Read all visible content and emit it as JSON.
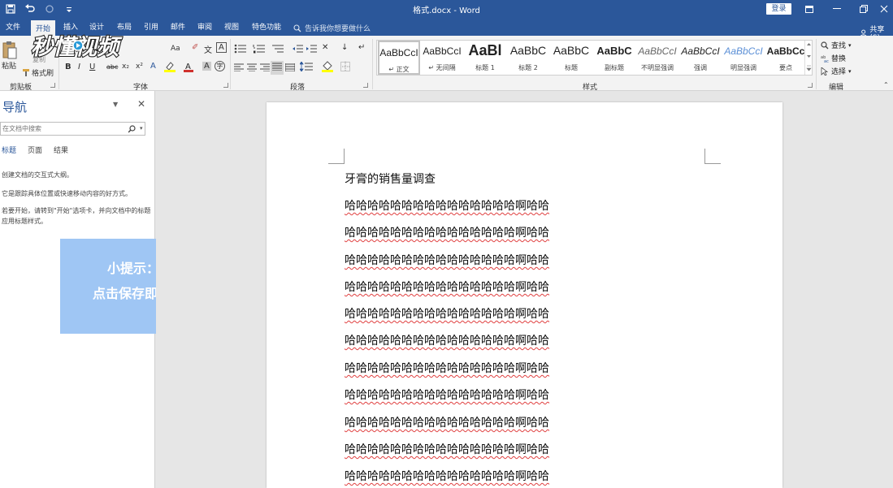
{
  "title_bar": {
    "doc_title": "格式.docx - Word",
    "login": "登录"
  },
  "tabs": [
    "文件",
    "开始",
    "插入",
    "设计",
    "布局",
    "引用",
    "邮件",
    "审阅",
    "视图",
    "特色功能"
  ],
  "tell_me": "告诉我你想要做什么",
  "share": "共享(S)",
  "ribbon": {
    "clipboard": {
      "paste": "粘贴",
      "copy": "复制",
      "format_painter": "格式刷",
      "label": "剪贴板"
    },
    "font": {
      "aa": "Aa",
      "bold": "B",
      "italic": "I",
      "underline": "U",
      "strike": "abc",
      "x2": "x₂",
      "x2sup": "x²",
      "label": "字体"
    },
    "paragraph": {
      "label": "段落"
    },
    "styles": {
      "label": "样式",
      "items": [
        {
          "sample": "AaBbCcI",
          "name": "↵ 正文"
        },
        {
          "sample": "AaBbCcI",
          "name": "↵ 无间隔"
        },
        {
          "sample": "AaBl",
          "name": "标题 1"
        },
        {
          "sample": "AaBbC",
          "name": "标题 2"
        },
        {
          "sample": "AaBbC",
          "name": "标题"
        },
        {
          "sample": "AaBbC",
          "name": "副标题"
        },
        {
          "sample": "AaBbCcI",
          "name": "不明显强调"
        },
        {
          "sample": "AaBbCcI",
          "name": "强调"
        },
        {
          "sample": "AaBbCcI",
          "name": "明显强调"
        },
        {
          "sample": "AaBbCc",
          "name": "要点"
        }
      ]
    },
    "editing": {
      "find": "查找",
      "replace": "替换",
      "select": "选择",
      "label": "编辑"
    }
  },
  "nav": {
    "title": "导航",
    "search_placeholder": "在文档中搜索",
    "tabs": [
      "标题",
      "页面",
      "结果"
    ],
    "text1": "创建文档的交互式大纲。",
    "text2": "它是跟踪具体位置或快速移动内容的好方式。",
    "text3": "若要开始，请转到\"开始\"选项卡，并向文档中的标题应用标题样式。"
  },
  "tip": {
    "line1": "小提示：",
    "line2": "点击保存即可"
  },
  "watermark": "秒懂视频",
  "document": {
    "heading": "牙膏的销售量调查",
    "lines": [
      "哈哈哈哈哈哈哈哈哈哈哈哈哈哈哈啊哈哈",
      "哈哈哈哈哈哈哈哈哈哈哈哈哈哈哈啊哈哈",
      "哈哈哈哈哈哈哈哈哈哈哈哈哈哈哈啊哈哈",
      "哈哈哈哈哈哈哈哈哈哈哈哈哈哈哈啊哈哈",
      "哈哈哈哈哈哈哈哈哈哈哈哈哈哈哈啊哈哈",
      "哈哈哈哈哈哈哈哈哈哈哈哈哈哈哈啊哈哈",
      "哈哈哈哈哈哈哈哈哈哈哈哈哈哈哈啊哈哈",
      "哈哈哈哈哈哈哈哈哈哈哈哈哈哈哈啊哈哈",
      "哈哈哈哈哈哈哈哈哈哈哈哈哈哈哈啊哈哈",
      "哈哈哈哈哈哈哈哈哈哈哈哈哈哈哈啊哈哈",
      "哈哈哈哈哈哈哈哈哈哈哈哈哈哈哈啊哈哈"
    ]
  },
  "colors": {
    "word_blue": "#2b579a",
    "tip_bg": "#9fc6f4",
    "spell_underline": "#e04040"
  }
}
